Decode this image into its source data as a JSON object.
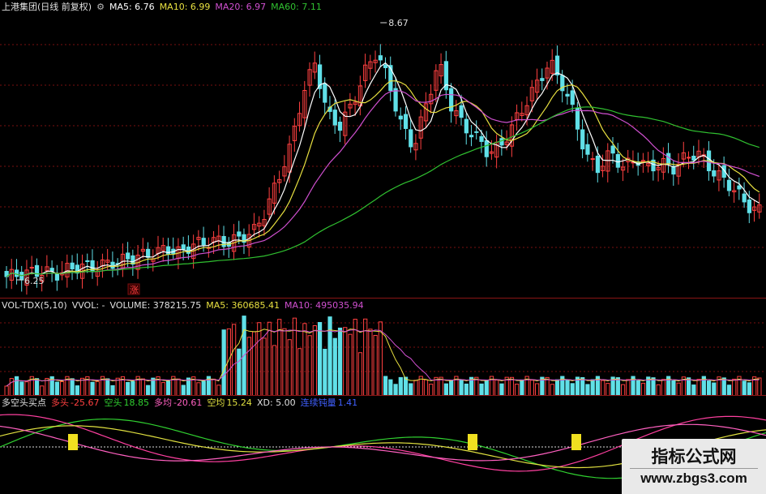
{
  "price_panel": {
    "stock_name": "上港集团",
    "period_mode": "(日线 前复权)",
    "ma5_label": "MA5: 6.76",
    "ma10_label": "MA10: 6.99",
    "ma20_label": "MA20: 6.97",
    "ma60_label": "MA60: 7.11",
    "high_label": "8.67",
    "low_label": "6.25",
    "marker_label": "涨",
    "colors": {
      "ma5": "#ffffff",
      "ma10": "#e8e040",
      "ma20": "#d050d0",
      "ma60": "#30c030",
      "up": "#ff4040",
      "down": "#60e0e8",
      "grid": "#7a1010"
    }
  },
  "volume_panel": {
    "indicator_name": "VOL-TDX(5,10)",
    "vol_label": "VVOL: -",
    "volume_value": "VOLUME: 378215.75",
    "ma5_value": "MA5: 360685.41",
    "ma10_value": "MA10: 495035.94"
  },
  "signal_panel": {
    "indicator_name": "多空头买点",
    "long_label": "多头",
    "long_value": "-25.67",
    "short_label": "空头",
    "short_value": "18.85",
    "long_avg_label": "多均",
    "long_avg_value": "-20.61",
    "short_avg_label": "空均",
    "short_avg_value": "15.24",
    "xd_label": "XD: 5.00",
    "extra_label": "连续钝量",
    "extra_value": "1.41",
    "signal_color": "#f0e020"
  },
  "watermark": {
    "title": "指标公式网",
    "url": "www.zbgs3.com"
  },
  "chart_data": {
    "type": "candlestick",
    "title": "上港集团 (日线 前复权)",
    "price_high": 8.67,
    "price_low": 6.25,
    "close": [
      6.28,
      6.3,
      6.32,
      6.33,
      6.3,
      6.35,
      6.38,
      6.36,
      6.4,
      6.42,
      6.45,
      6.48,
      6.5,
      6.55,
      6.5,
      6.58,
      6.6,
      6.62,
      6.6,
      6.65,
      6.7,
      6.9,
      7.2,
      7.5,
      8.0,
      8.3,
      7.8,
      7.7,
      7.9,
      8.2,
      8.4,
      8.1,
      7.7,
      7.5,
      7.9,
      8.3,
      7.9,
      7.7,
      7.6,
      7.45,
      7.5,
      7.7,
      7.9,
      8.1,
      8.3,
      8.1,
      7.8,
      7.4,
      7.3,
      7.45,
      7.3,
      7.4,
      7.3,
      7.35,
      7.3,
      7.4,
      7.45,
      7.3,
      7.2,
      7.1,
      6.95,
      6.9
    ],
    "series": [
      {
        "name": "MA5",
        "value": 6.76
      },
      {
        "name": "MA10",
        "value": 6.99
      },
      {
        "name": "MA20",
        "value": 6.97
      },
      {
        "name": "MA60",
        "value": 7.11
      }
    ]
  }
}
